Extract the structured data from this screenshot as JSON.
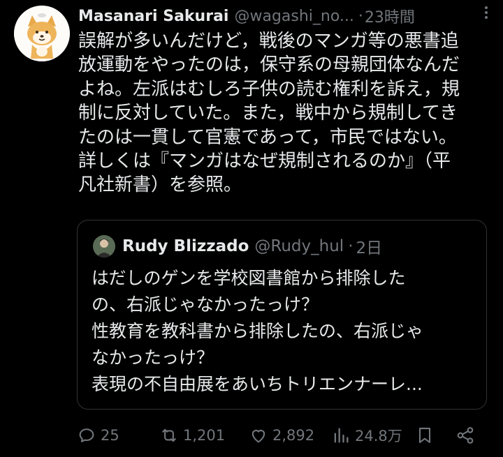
{
  "tweet": {
    "author_name": "Masanari Sakurai",
    "author_handle": "@wagashi_no...",
    "separator": "·",
    "time": "23時間",
    "text": "誤解が多いんだけど，戦後のマンガ等の悪書追\n放運動をやったのは，保守系の母親団体なんだ\nよね。左派はむしろ子供の読む権利を訴え，規\n制に反対していた。また，戦中から規制してき\nたのは一貫して官憲であって，市民ではない。\n詳しくは『マンガはなぜ規制されるのか』（平\n凡社新書）を参照。"
  },
  "quote": {
    "author_name": "Rudy Blizzado",
    "author_handle": "@Rudy_hul",
    "separator": "·",
    "time": "2日",
    "text": "はだしのゲンを学校図書館から排除した\nの、右派じゃなかったっけ？\n性教育を教科書から排除したの、右派じゃ\nなかったっけ？\n表現の不自由展をあいちトリエンナーレ..."
  },
  "actions": {
    "replies": "25",
    "retweets": "1,201",
    "likes": "2,892",
    "views": "24.8万"
  },
  "icons": {
    "more": "more-dots-icon",
    "reply": "reply-bubble-icon",
    "retweet": "retweet-icon",
    "like": "heart-icon",
    "views": "views-bars-icon",
    "bookmark": "bookmark-icon",
    "share": "share-icon"
  },
  "colors": {
    "background": "#000000",
    "text": "#e7e9ea",
    "muted": "#71767b",
    "border": "#2f3336"
  }
}
